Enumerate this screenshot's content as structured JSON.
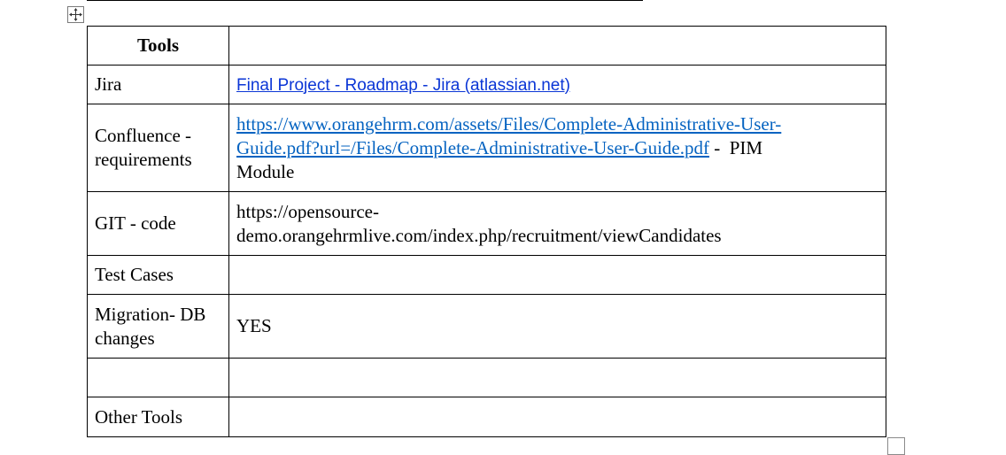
{
  "table": {
    "header": {
      "tool": "Tools",
      "value": ""
    },
    "rows": [
      {
        "label": "Jira",
        "link": "Final Project - Roadmap - Jira (atlassian.net)"
      },
      {
        "label_line1": "Confluence -",
        "label_line2": "requirements",
        "link_line1": "https://www.orangehrm.com/assets/Files/Complete-Administrative-User-",
        "link_line2": "Guide.pdf?url=/Files/Complete-Administrative-User-Guide.pdf",
        "suffix": " -  PIM",
        "suffix_line2": "Module"
      },
      {
        "label": "GIT - code",
        "value_line1": "https://opensource-",
        "value_line2": "demo.orangehrmlive.com/index.php/recruitment/viewCandidates"
      },
      {
        "label": "Test Cases",
        "value": ""
      },
      {
        "label_line1": "Migration- DB",
        "label_line2": "changes",
        "value": "YES"
      },
      {
        "label": "",
        "value": ""
      },
      {
        "label": "Other Tools",
        "value": ""
      }
    ]
  },
  "icons": {
    "move": "move-arrows-icon",
    "resize": "resize-handle-icon"
  },
  "colors": {
    "link_sans": "#0b36d6",
    "link_serif": "#0563c1",
    "border": "#000000"
  }
}
